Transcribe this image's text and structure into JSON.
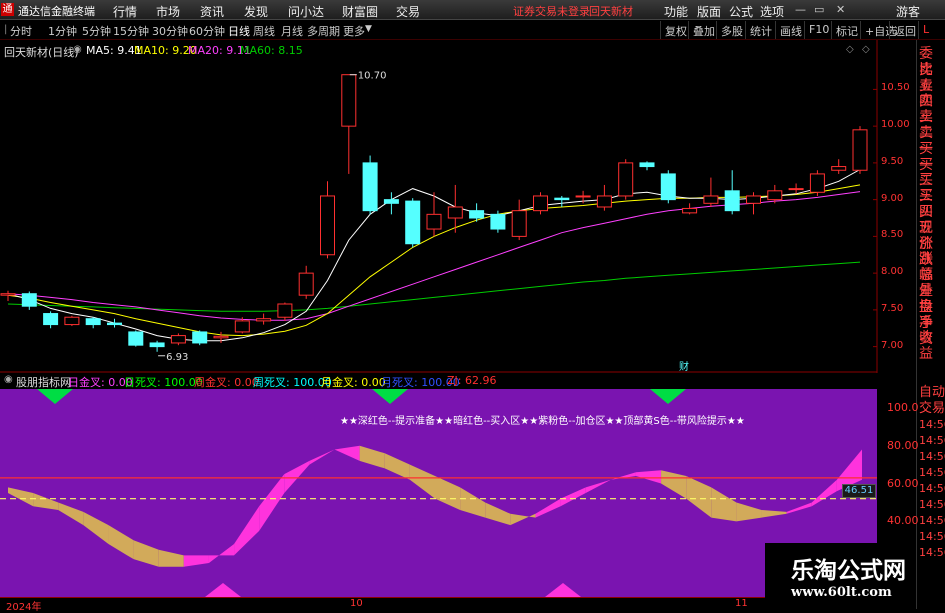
{
  "menu": {
    "app_title": "通达信金融终端",
    "items": [
      "行情",
      "市场",
      "资讯",
      "发现",
      "问小达",
      "财富圈",
      "交易"
    ],
    "warning": "证券交易未登录",
    "stock_name": "回天新材",
    "right_items": [
      "功能",
      "版面",
      "公式",
      "选项"
    ],
    "guest": "游客"
  },
  "toolbar": {
    "periods": [
      "分时",
      "1分钟",
      "5分钟",
      "15分钟",
      "30分钟",
      "60分钟",
      "日线",
      "周线",
      "月线",
      "多周期",
      "更多"
    ],
    "active_period": "日线",
    "right_buttons": [
      "复权",
      "叠加",
      "多股",
      "统计",
      "画线",
      "F10",
      "标记",
      "+自选",
      "返回"
    ],
    "corner": "L"
  },
  "chart_info": {
    "title": "回天新材(日线)",
    "ma5_label": "MA5: 9.41",
    "ma10_label": "MA10: 9.20",
    "ma20_label": "MA20: 9.11",
    "ma60_label": "MA60: 8.15",
    "ma5_color": "#ffffff",
    "ma10_color": "#ffff00",
    "ma20_color": "#ff40ff",
    "ma60_color": "#00cc00",
    "high_label": "10.70",
    "low_label": "6.93",
    "cai_label": "财"
  },
  "right_panel": [
    "委比",
    "卖五",
    "卖四",
    "卖三",
    "卖二",
    "卖一",
    "买一",
    "买二",
    "买三",
    "买四",
    "买五",
    "现价",
    "涨跌",
    "涨幅",
    "总量",
    "外盘",
    "换手",
    "净资",
    "收益"
  ],
  "right_panel_lower": [
    "自动",
    "交易",
    "14:56",
    "14:56",
    "14:56",
    "14:56",
    "14:56",
    "14:56",
    "14:56",
    "14:56",
    "14:56"
  ],
  "indicator": {
    "name": "股朋指标网",
    "fields": [
      {
        "label": "日金叉: 0.00",
        "color": "#ff40ff"
      },
      {
        "label": "日死叉: 100.00",
        "color": "#00ff00"
      },
      {
        "label": "周金叉: 0.00",
        "color": "#ff3030"
      },
      {
        "label": "周死叉: 100.00",
        "color": "#00ffff"
      },
      {
        "label": "月金叉: 0.00",
        "color": "#ffff00"
      },
      {
        "label": "月死叉: 100.00",
        "color": "#3050ff"
      },
      {
        "label": "ZJ: 62.96",
        "color": "#ff3030"
      }
    ],
    "banner": "★★深红色--提示准备★★暗红色--买入区★★紫粉色--加仓区★★顶部黄S色--带风险提示★★",
    "current_value": "46.51"
  },
  "time_axis": {
    "labels": [
      "2024年",
      "10",
      "11"
    ]
  },
  "logo": {
    "line1": "乐淘公式网",
    "line2": "www.60lt.com"
  },
  "chart_data": [
    {
      "type": "candlestick",
      "title": "回天新材(日线)",
      "y_ticks": [
        7.0,
        7.5,
        8.0,
        8.5,
        9.0,
        9.5,
        10.0,
        10.5
      ],
      "ylim": [
        6.75,
        10.9
      ],
      "candles": [
        {
          "o": 7.7,
          "c": 7.72,
          "h": 7.76,
          "l": 7.62
        },
        {
          "o": 7.72,
          "c": 7.55,
          "h": 7.75,
          "l": 7.5
        },
        {
          "o": 7.45,
          "c": 7.3,
          "h": 7.48,
          "l": 7.25
        },
        {
          "o": 7.3,
          "c": 7.4,
          "h": 7.42,
          "l": 7.28
        },
        {
          "o": 7.38,
          "c": 7.3,
          "h": 7.4,
          "l": 7.25
        },
        {
          "o": 7.32,
          "c": 7.3,
          "h": 7.38,
          "l": 7.26
        },
        {
          "o": 7.2,
          "c": 7.02,
          "h": 7.22,
          "l": 7.0
        },
        {
          "o": 7.05,
          "c": 7.0,
          "h": 7.08,
          "l": 6.93
        },
        {
          "o": 7.05,
          "c": 7.15,
          "h": 7.18,
          "l": 7.02
        },
        {
          "o": 7.2,
          "c": 7.05,
          "h": 7.22,
          "l": 7.02
        },
        {
          "o": 7.12,
          "c": 7.14,
          "h": 7.2,
          "l": 7.05
        },
        {
          "o": 7.2,
          "c": 7.35,
          "h": 7.4,
          "l": 7.18
        },
        {
          "o": 7.35,
          "c": 7.38,
          "h": 7.45,
          "l": 7.3
        },
        {
          "o": 7.4,
          "c": 7.58,
          "h": 7.6,
          "l": 7.35
        },
        {
          "o": 7.7,
          "c": 8.0,
          "h": 8.1,
          "l": 7.65
        },
        {
          "o": 8.25,
          "c": 9.05,
          "h": 9.25,
          "l": 8.2
        },
        {
          "o": 10.0,
          "c": 10.7,
          "h": 10.7,
          "l": 9.35
        },
        {
          "o": 9.5,
          "c": 8.85,
          "h": 9.6,
          "l": 8.8
        },
        {
          "o": 9.0,
          "c": 8.95,
          "h": 9.1,
          "l": 8.8
        },
        {
          "o": 8.98,
          "c": 8.4,
          "h": 9.02,
          "l": 8.35
        },
        {
          "o": 8.6,
          "c": 8.8,
          "h": 9.1,
          "l": 8.5
        },
        {
          "o": 8.75,
          "c": 8.9,
          "h": 9.2,
          "l": 8.55
        },
        {
          "o": 8.85,
          "c": 8.75,
          "h": 8.95,
          "l": 8.7
        },
        {
          "o": 8.8,
          "c": 8.6,
          "h": 8.85,
          "l": 8.55
        },
        {
          "o": 8.5,
          "c": 8.85,
          "h": 9.0,
          "l": 8.45
        },
        {
          "o": 8.85,
          "c": 9.05,
          "h": 9.1,
          "l": 8.8
        },
        {
          "o": 9.02,
          "c": 9.0,
          "h": 9.05,
          "l": 8.9
        },
        {
          "o": 9.05,
          "c": 9.05,
          "h": 9.12,
          "l": 8.95
        },
        {
          "o": 8.9,
          "c": 9.05,
          "h": 9.2,
          "l": 8.85
        },
        {
          "o": 9.05,
          "c": 9.5,
          "h": 9.55,
          "l": 9.0
        },
        {
          "o": 9.5,
          "c": 9.45,
          "h": 9.52,
          "l": 9.4
        },
        {
          "o": 9.35,
          "c": 9.0,
          "h": 9.4,
          "l": 8.95
        },
        {
          "o": 8.82,
          "c": 8.88,
          "h": 8.95,
          "l": 8.8
        },
        {
          "o": 8.95,
          "c": 9.05,
          "h": 9.3,
          "l": 8.9
        },
        {
          "o": 9.12,
          "c": 8.85,
          "h": 9.4,
          "l": 8.8
        },
        {
          "o": 8.95,
          "c": 9.05,
          "h": 9.1,
          "l": 8.8
        },
        {
          "o": 9.0,
          "c": 9.12,
          "h": 9.2,
          "l": 8.95
        },
        {
          "o": 9.15,
          "c": 9.15,
          "h": 9.22,
          "l": 9.08
        },
        {
          "o": 9.1,
          "c": 9.35,
          "h": 9.4,
          "l": 9.05
        },
        {
          "o": 9.4,
          "c": 9.45,
          "h": 9.55,
          "l": 9.35
        },
        {
          "o": 9.4,
          "c": 9.95,
          "h": 10.0,
          "l": 9.35
        }
      ],
      "ma5": [
        7.72,
        7.64,
        7.52,
        7.45,
        7.4,
        7.32,
        7.24,
        7.15,
        7.1,
        7.08,
        7.08,
        7.12,
        7.19,
        7.3,
        7.48,
        7.9,
        8.45,
        8.8,
        9.0,
        9.15,
        9.05,
        8.9,
        8.82,
        8.78,
        8.85,
        8.92,
        8.95,
        8.98,
        9.0,
        9.08,
        9.1,
        9.05,
        9.02,
        9.02,
        9.0,
        9.02,
        9.05,
        9.08,
        9.15,
        9.25,
        9.41
      ],
      "ma10": [
        7.7,
        7.66,
        7.6,
        7.55,
        7.5,
        7.45,
        7.38,
        7.32,
        7.26,
        7.2,
        7.16,
        7.15,
        7.17,
        7.21,
        7.29,
        7.45,
        7.7,
        7.95,
        8.15,
        8.35,
        8.5,
        8.62,
        8.72,
        8.8,
        8.85,
        8.88,
        8.9,
        8.92,
        8.95,
        8.98,
        9.0,
        9.02,
        9.02,
        9.03,
        9.03,
        9.04,
        9.05,
        9.07,
        9.1,
        9.15,
        9.2
      ],
      "ma20": [
        7.72,
        7.7,
        7.67,
        7.64,
        7.6,
        7.57,
        7.54,
        7.5,
        7.46,
        7.42,
        7.39,
        7.37,
        7.36,
        7.36,
        7.38,
        7.45,
        7.55,
        7.65,
        7.75,
        7.85,
        7.95,
        8.05,
        8.15,
        8.25,
        8.35,
        8.45,
        8.55,
        8.62,
        8.68,
        8.74,
        8.8,
        8.85,
        8.88,
        8.91,
        8.93,
        8.95,
        8.98,
        9.0,
        9.03,
        9.07,
        9.11
      ],
      "ma60": [
        7.58,
        7.57,
        7.56,
        7.55,
        7.54,
        7.53,
        7.52,
        7.51,
        7.5,
        7.49,
        7.48,
        7.48,
        7.48,
        7.49,
        7.5,
        7.52,
        7.55,
        7.58,
        7.61,
        7.64,
        7.67,
        7.7,
        7.73,
        7.76,
        7.79,
        7.82,
        7.85,
        7.88,
        7.9,
        7.93,
        7.95,
        7.97,
        7.99,
        8.01,
        8.03,
        8.05,
        8.07,
        8.09,
        8.11,
        8.13,
        8.15
      ]
    },
    {
      "type": "area",
      "title": "股朋指标网",
      "y_ticks": [
        40.0,
        60.0,
        80.0,
        100.0
      ],
      "ylim": [
        0,
        110
      ],
      "reference_lines": [
        {
          "y": 63,
          "color": "#ff3030"
        },
        {
          "y": 52,
          "color": "#ffff66",
          "dashed": true
        }
      ],
      "series": [
        {
          "name": "A",
          "values": [
            58,
            55,
            50,
            45,
            38,
            30,
            25,
            22,
            22,
            22,
            35,
            55,
            70,
            78,
            80,
            76,
            70,
            64,
            58,
            50,
            44,
            42,
            48,
            55,
            62,
            66,
            67,
            64,
            58,
            50,
            46,
            45,
            50,
            62,
            78
          ]
        },
        {
          "name": "B",
          "values": [
            55,
            48,
            46,
            38,
            28,
            20,
            16,
            16,
            18,
            28,
            48,
            65,
            72,
            78,
            72,
            68,
            62,
            52,
            46,
            42,
            38,
            44,
            52,
            58,
            62,
            64,
            60,
            52,
            42,
            40,
            42,
            44,
            48,
            56,
            62
          ]
        }
      ]
    }
  ]
}
